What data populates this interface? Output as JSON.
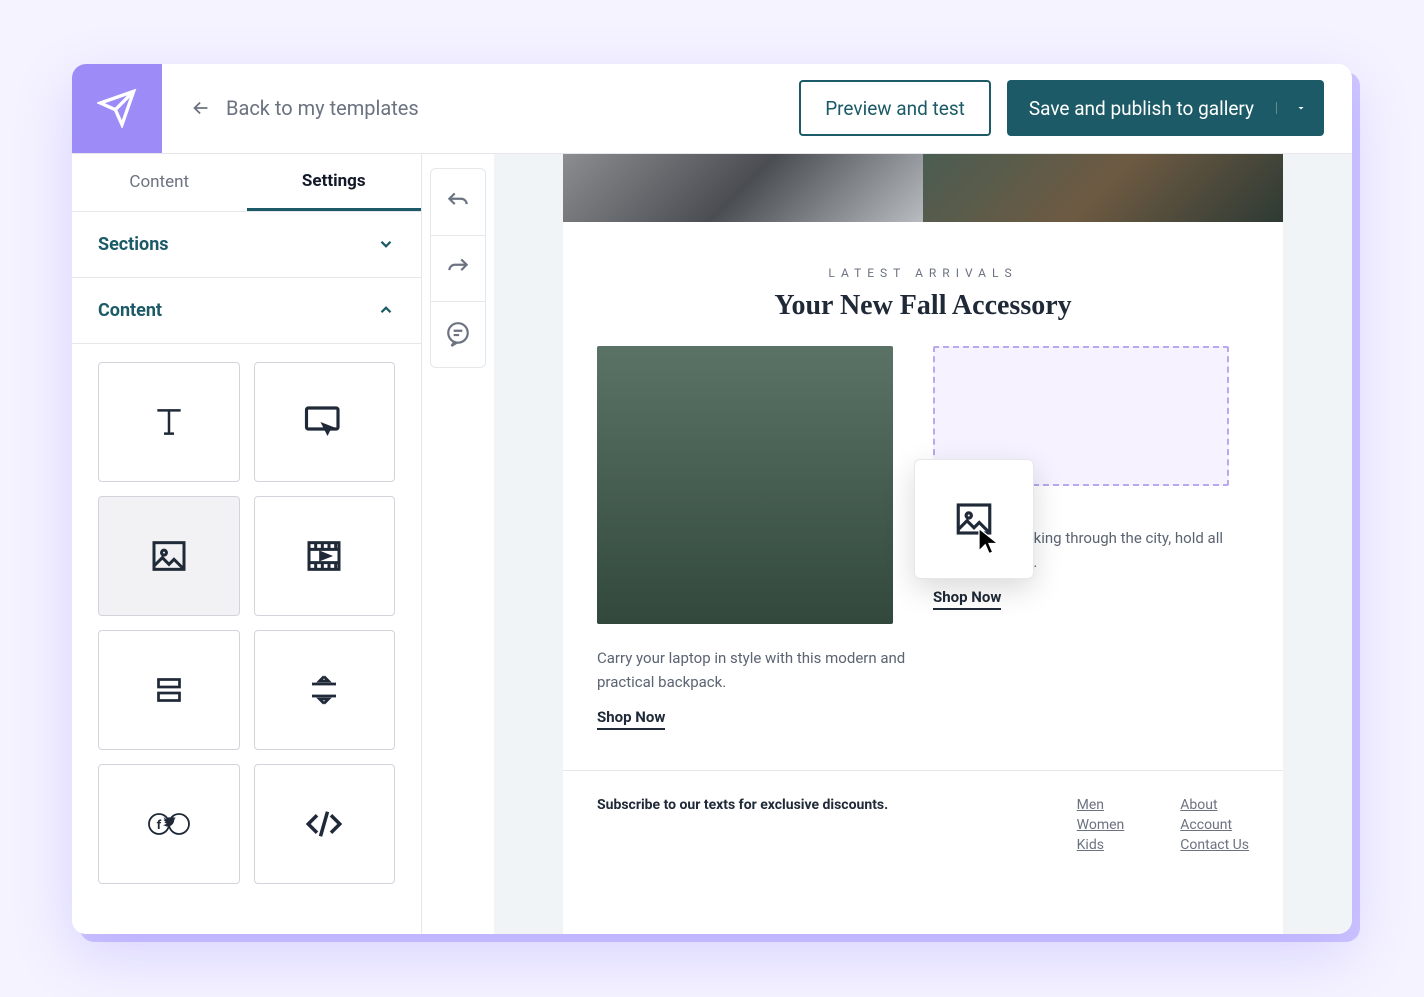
{
  "topbar": {
    "back_label": "Back to my templates",
    "preview_label": "Preview and test",
    "publish_label": "Save and publish to gallery"
  },
  "sidebar": {
    "tabs": {
      "content": "Content",
      "settings": "Settings"
    },
    "sections_label": "Sections",
    "content_label": "Content",
    "blocks": {
      "text": "text-block",
      "button": "button-block",
      "image": "image-block",
      "video": "video-block",
      "spacer": "spacer-block",
      "divider": "divider-block",
      "social": "social-block",
      "code": "code-block"
    }
  },
  "canvas": {
    "eyebrow": "LATEST ARRIVALS",
    "headline": "Your New Fall Accessory",
    "left_desc": "Carry your laptop in style with this modern and practical backpack.",
    "left_cta": "Shop Now",
    "right_desc": "re hiking or walking through the city, hold all your essentials.",
    "right_cta": "Shop Now"
  },
  "footer": {
    "cta": "Subscribe to our texts for exclusive discounts.",
    "col1": [
      "Men",
      "Women",
      "Kids"
    ],
    "col2": [
      "About",
      "Account",
      "Contact Us"
    ]
  }
}
